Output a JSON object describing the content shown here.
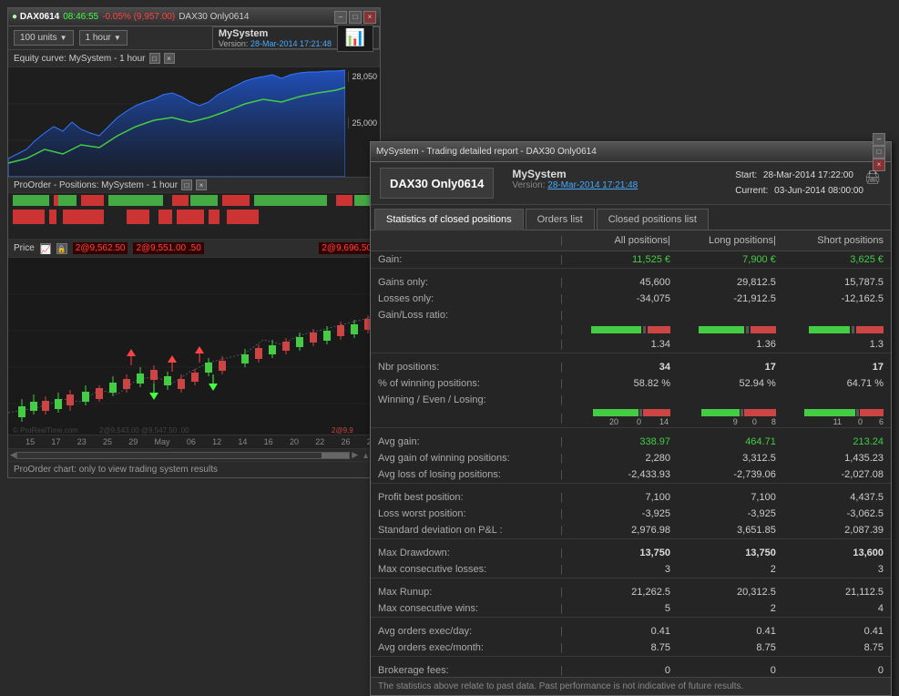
{
  "chart_window": {
    "title": "DAX0614",
    "time": "08:46:55",
    "change": "-0.05% (9,957.00)",
    "subtitle": "DAX30 Only0614",
    "units_label": "100 units",
    "timeframe_label": "1 hour",
    "system_name": "MySystem",
    "system_version_label": "Version:",
    "system_version_date": "28-Mar-2014 17:21:48",
    "equity_label": "Equity curve: MySystem - 1 hour",
    "price_28050": "28,050",
    "price_25000": "25,000",
    "proorder_label": "ProOrder - Positions: MySystem - 1 hour",
    "price_labels": [
      "2@9,562.50",
      "2@9,551.00 .50",
      "2@9,696.50"
    ],
    "date_axis": [
      "15",
      "17",
      "23",
      "25",
      "29",
      "May",
      "06",
      "12",
      "14",
      "16",
      "20",
      "22",
      "26",
      "2"
    ],
    "chart_footer": "ProOrder chart: only to view trading system results",
    "win_buttons": [
      "-",
      "□",
      "×"
    ]
  },
  "stats_window": {
    "title": "MySystem - Trading detailed report - DAX30 Only0614",
    "instrument": "DAX30 Only0614",
    "system_name": "MySystem",
    "version_label": "Version:",
    "version_date": "28-Mar-2014 17:21:48",
    "start_label": "Start:",
    "start_date": "28-Mar-2014 17:22:00",
    "current_label": "Current:",
    "current_date": "03-Jun-2014 08:00:00",
    "win_buttons": [
      "-",
      "□",
      "×"
    ],
    "tabs": [
      "Statistics of closed positions",
      "Orders list",
      "Closed positions list"
    ],
    "active_tab": 0,
    "table": {
      "col_headers": [
        "",
        "|",
        "All positions|",
        "Long positions|",
        "Short positions"
      ],
      "rows": [
        {
          "type": "value",
          "label": "Gain:",
          "all": "11,525 €",
          "all_color": "green",
          "long": "7,900 €",
          "long_color": "green",
          "short": "3,625 €",
          "short_color": "green"
        },
        {
          "type": "separator"
        },
        {
          "type": "value",
          "label": "Gains only:",
          "all": "45,600",
          "all_color": "normal",
          "long": "29,812.5",
          "long_color": "normal",
          "short": "15,787.5",
          "short_color": "normal"
        },
        {
          "type": "value",
          "label": "Losses only:",
          "all": "-34,075",
          "all_color": "normal",
          "long": "-21,912.5",
          "long_color": "normal",
          "short": "-12,162.5",
          "short_color": "normal"
        },
        {
          "type": "value",
          "label": "Gain/Loss ratio:",
          "all": "",
          "long": "",
          "short": ""
        },
        {
          "type": "bars_gl",
          "all_green": 70,
          "all_red": 30,
          "long_green": 65,
          "long_red": 35,
          "short_green": 58,
          "short_red": 42
        },
        {
          "type": "value",
          "label": "",
          "all": "1.34",
          "all_color": "normal",
          "long": "1.36",
          "long_color": "normal",
          "short": "1.3",
          "short_color": "normal"
        },
        {
          "type": "separator"
        },
        {
          "type": "value",
          "label": "Nbr positions:",
          "all": "34",
          "all_color": "bold",
          "long": "17",
          "long_color": "bold",
          "short": "17",
          "short_color": "bold"
        },
        {
          "type": "value",
          "label": "% of winning positions:",
          "all": "58.82 %",
          "all_color": "normal",
          "long": "52.94 %",
          "long_color": "normal",
          "short": "64.71 %",
          "short_color": "normal"
        },
        {
          "type": "value",
          "label": "Winning / Even / Losing:",
          "all": "",
          "long": "",
          "short": ""
        },
        {
          "type": "bars_wl",
          "all_green": 58,
          "all_mid": 2,
          "all_red": 40,
          "all_nums": [
            20,
            0,
            14
          ],
          "long_green": 52,
          "long_mid": 2,
          "long_red": 46,
          "long_nums": [
            9,
            0,
            8
          ],
          "short_green": 64,
          "short_mid": 2,
          "short_red": 34,
          "short_nums": [
            11,
            0,
            6
          ]
        },
        {
          "type": "separator"
        },
        {
          "type": "value",
          "label": "Avg gain:",
          "all": "338.97",
          "all_color": "green",
          "long": "464.71",
          "long_color": "green",
          "short": "213.24",
          "short_color": "green"
        },
        {
          "type": "value",
          "label": "Avg gain of winning positions:",
          "all": "2,280",
          "all_color": "normal",
          "long": "3,312.5",
          "long_color": "normal",
          "short": "1,435.23",
          "short_color": "normal"
        },
        {
          "type": "value",
          "label": "Avg loss of losing positions:",
          "all": "-2,433.93",
          "all_color": "normal",
          "long": "-2,739.06",
          "long_color": "normal",
          "short": "-2,027.08",
          "short_color": "normal"
        },
        {
          "type": "separator"
        },
        {
          "type": "value",
          "label": "Profit best position:",
          "all": "7,100",
          "all_color": "normal",
          "long": "7,100",
          "long_color": "normal",
          "short": "4,437.5",
          "short_color": "normal"
        },
        {
          "type": "value",
          "label": "Loss worst position:",
          "all": "-3,925",
          "all_color": "normal",
          "long": "-3,925",
          "long_color": "normal",
          "short": "-3,062.5",
          "short_color": "normal"
        },
        {
          "type": "value",
          "label": "Standard deviation on P&L :",
          "all": "2,976.98",
          "all_color": "normal",
          "long": "3,651.85",
          "long_color": "normal",
          "short": "2,087.39",
          "short_color": "normal"
        },
        {
          "type": "separator"
        },
        {
          "type": "value",
          "label": "Max Drawdown:",
          "all": "13,750",
          "all_color": "bold",
          "long": "13,750",
          "long_color": "bold",
          "short": "13,600",
          "short_color": "bold"
        },
        {
          "type": "value",
          "label": "Max consecutive losses:",
          "all": "3",
          "all_color": "normal",
          "long": "2",
          "long_color": "normal",
          "short": "3",
          "short_color": "normal"
        },
        {
          "type": "separator"
        },
        {
          "type": "value",
          "label": "Max Runup:",
          "all": "21,262.5",
          "all_color": "normal",
          "long": "20,312.5",
          "long_color": "normal",
          "short": "21,112.5",
          "short_color": "normal"
        },
        {
          "type": "value",
          "label": "Max consecutive wins:",
          "all": "5",
          "all_color": "normal",
          "long": "2",
          "long_color": "normal",
          "short": "4",
          "short_color": "normal"
        },
        {
          "type": "separator"
        },
        {
          "type": "value",
          "label": "Avg orders exec/day:",
          "all": "0.41",
          "all_color": "normal",
          "long": "0.41",
          "long_color": "normal",
          "short": "0.41",
          "short_color": "normal"
        },
        {
          "type": "value",
          "label": "Avg orders exec/month:",
          "all": "8.75",
          "all_color": "normal",
          "long": "8.75",
          "long_color": "normal",
          "short": "8.75",
          "short_color": "normal"
        },
        {
          "type": "separator"
        },
        {
          "type": "value",
          "label": "Brokerage fees:",
          "all": "0",
          "all_color": "normal",
          "long": "0",
          "long_color": "normal",
          "short": "0",
          "short_color": "normal"
        }
      ]
    },
    "footer_note": "The statistics above relate to past data. Past performance is not indicative of future results."
  }
}
